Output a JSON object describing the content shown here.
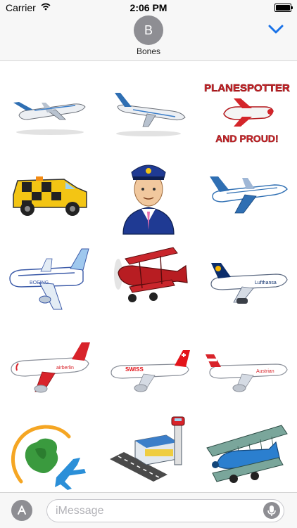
{
  "status": {
    "carrier": "Carrier",
    "time": "2:06 PM"
  },
  "header": {
    "avatar_initial": "B",
    "contact_name": "Bones"
  },
  "stickers": [
    {
      "name": "sticker-jet-blue-1",
      "text": ""
    },
    {
      "name": "sticker-jet-blue-2",
      "text": ""
    },
    {
      "name": "sticker-planespotter",
      "text": "PLANESPOTTER",
      "text2": "AND PROUD!"
    },
    {
      "name": "sticker-follow-me-car",
      "text": ""
    },
    {
      "name": "sticker-pilot",
      "text": ""
    },
    {
      "name": "sticker-airbus-jet",
      "text": ""
    },
    {
      "name": "sticker-boeing-jet",
      "text": "BOEING"
    },
    {
      "name": "sticker-red-biplane",
      "text": ""
    },
    {
      "name": "sticker-lufthansa-jet",
      "text": "Lufthansa"
    },
    {
      "name": "sticker-airberlin-jet",
      "text": "airberlin"
    },
    {
      "name": "sticker-swiss-jet",
      "text": "SWISS"
    },
    {
      "name": "sticker-austrian-jet",
      "text": "Austrian"
    },
    {
      "name": "sticker-world-travel-logo",
      "text": ""
    },
    {
      "name": "sticker-airport-terminal",
      "text": ""
    },
    {
      "name": "sticker-blue-biplane",
      "text": ""
    }
  ],
  "compose": {
    "placeholder": "iMessage"
  },
  "icons": {
    "apps": "app-store-icon",
    "mic": "microphone-icon",
    "chevron": "chevron-down-icon"
  }
}
